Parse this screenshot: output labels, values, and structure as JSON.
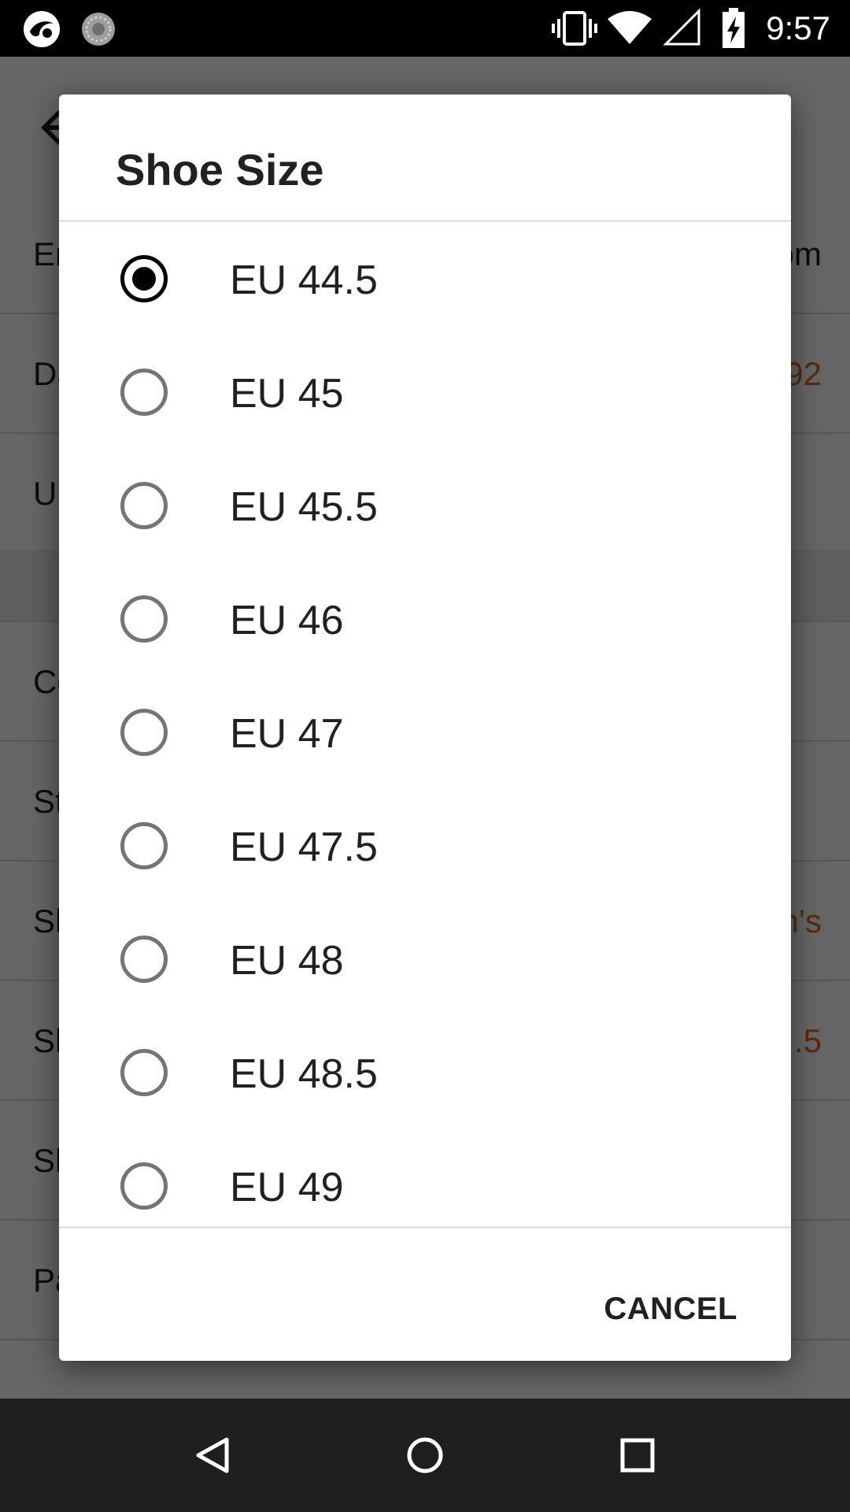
{
  "status_bar": {
    "time": "9:57",
    "icons": [
      "app-icon",
      "sync-icon",
      "vibrate-icon",
      "wifi-icon",
      "signal-icon",
      "battery-charging-icon"
    ]
  },
  "background_screen": {
    "rows": [
      {
        "label": "Er",
        "value": "om",
        "accent": false
      },
      {
        "label": "Da",
        "value": "92",
        "accent": true
      },
      {
        "label": "Ur",
        "value": "",
        "accent": false
      },
      {
        "label": "Co",
        "value": "",
        "accent": false
      },
      {
        "label": "St",
        "value": "",
        "accent": false
      },
      {
        "label": "Sh",
        "value": "n's",
        "accent": true
      },
      {
        "label": "Sh",
        "value": ".5",
        "accent": true
      },
      {
        "label": "Sh",
        "value": "",
        "accent": false
      },
      {
        "label": "Pa",
        "value": "",
        "accent": false
      }
    ]
  },
  "dialog": {
    "title": "Shoe Size",
    "selected_index": 0,
    "options": [
      "EU 44.5",
      "EU 45",
      "EU 45.5",
      "EU 46",
      "EU 47",
      "EU 47.5",
      "EU 48",
      "EU 48.5",
      "EU 49"
    ],
    "cancel_label": "CANCEL"
  },
  "nav_bar": {
    "buttons": [
      "back-icon",
      "home-icon",
      "recents-icon"
    ]
  },
  "colors": {
    "accent": "#e0691e",
    "scrim": "rgba(0,0,0,0.6)",
    "radio_checked": "#000000",
    "radio_unchecked": "#757575"
  }
}
